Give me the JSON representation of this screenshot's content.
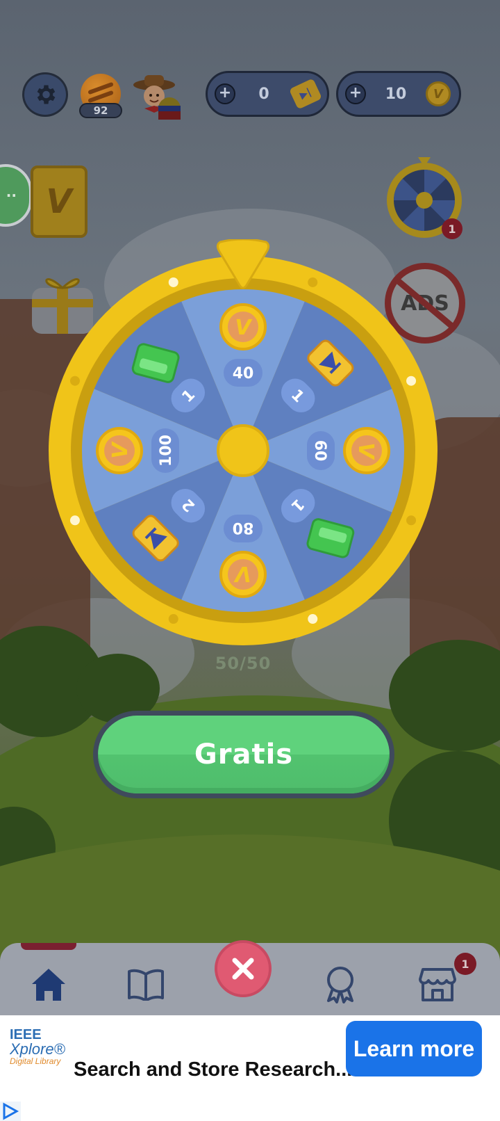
{
  "header": {
    "level": "92",
    "tickets": {
      "value": "0",
      "add_icon": "plus-icon",
      "icon": "ticket-icon"
    },
    "coins": {
      "value": "10",
      "add_icon": "plus-icon",
      "icon": "coin-icon",
      "coin_letter": "V"
    }
  },
  "side": {
    "chat_label": "··",
    "book_letter": "V",
    "wheel_badge": "1",
    "ads_label": "ADS"
  },
  "wheel": {
    "segments": [
      {
        "reward": "coin",
        "label": "40"
      },
      {
        "reward": "ticket",
        "label": "1"
      },
      {
        "reward": "coin",
        "label": "60"
      },
      {
        "reward": "gem",
        "label": "1"
      },
      {
        "reward": "coin",
        "label": "80"
      },
      {
        "reward": "ticket",
        "label": "2"
      },
      {
        "reward": "coin",
        "label": "100"
      },
      {
        "reward": "gem",
        "label": "1"
      }
    ],
    "coin_letter": "V",
    "spins_left": "50/50"
  },
  "actions": {
    "spin_label": "Gratis"
  },
  "bottom_nav": {
    "tabs": [
      "home-icon",
      "book-icon",
      "trophy-icon",
      "badge-icon",
      "shop-icon"
    ],
    "shop_badge": "1",
    "close_icon": "close-icon"
  },
  "ad": {
    "brand_line1": "IEEE",
    "brand_line2": "Xplore®",
    "brand_line3": "Digital Library",
    "headline": "Search and Store Research...",
    "cta": "Learn more"
  },
  "colors": {
    "wheel_rim": "#f0c419",
    "wheel_light": "#7b9fd9",
    "wheel_dark": "#5f80c0",
    "gratis": "#5fd27c",
    "close": "#e05a72",
    "ad_cta": "#1a73e8"
  }
}
